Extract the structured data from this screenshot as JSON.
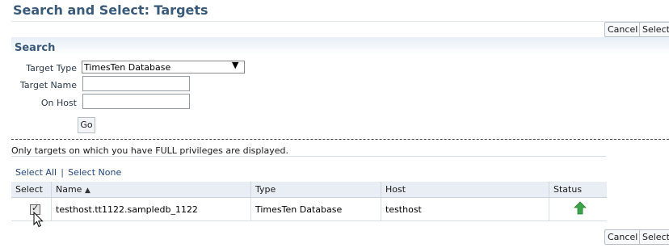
{
  "page": {
    "title": "Search and Select: Targets"
  },
  "buttons": {
    "cancel": "Cancel",
    "select": "Select",
    "go": "Go"
  },
  "search": {
    "header": "Search",
    "target_type_label": "Target Type",
    "target_type_value": "TimesTen Database",
    "target_name_label": "Target Name",
    "target_name_value": "",
    "on_host_label": "On Host",
    "on_host_value": ""
  },
  "note": "Only targets on which you have FULL privileges are displayed.",
  "selection_links": {
    "select_all": "Select All",
    "select_none": "Select None"
  },
  "table": {
    "columns": {
      "select": "Select",
      "name": "Name",
      "type": "Type",
      "host": "Host",
      "status": "Status"
    },
    "sort_column": "Name",
    "sort_direction": "ascending",
    "rows": [
      {
        "selected": true,
        "name": "testhost.tt1122.sampledb_1122",
        "type": "TimesTen Database",
        "host": "testhost",
        "status": "up"
      }
    ]
  },
  "colors": {
    "title": "#3a5a7a",
    "status_up": "#3aa548",
    "link": "#23467a"
  },
  "icons": {
    "sort": "sort-ascending-icon",
    "status": "status-up-arrow-icon",
    "dropdown": "dropdown-arrow-icon",
    "cursor": "mouse-pointer-icon"
  }
}
